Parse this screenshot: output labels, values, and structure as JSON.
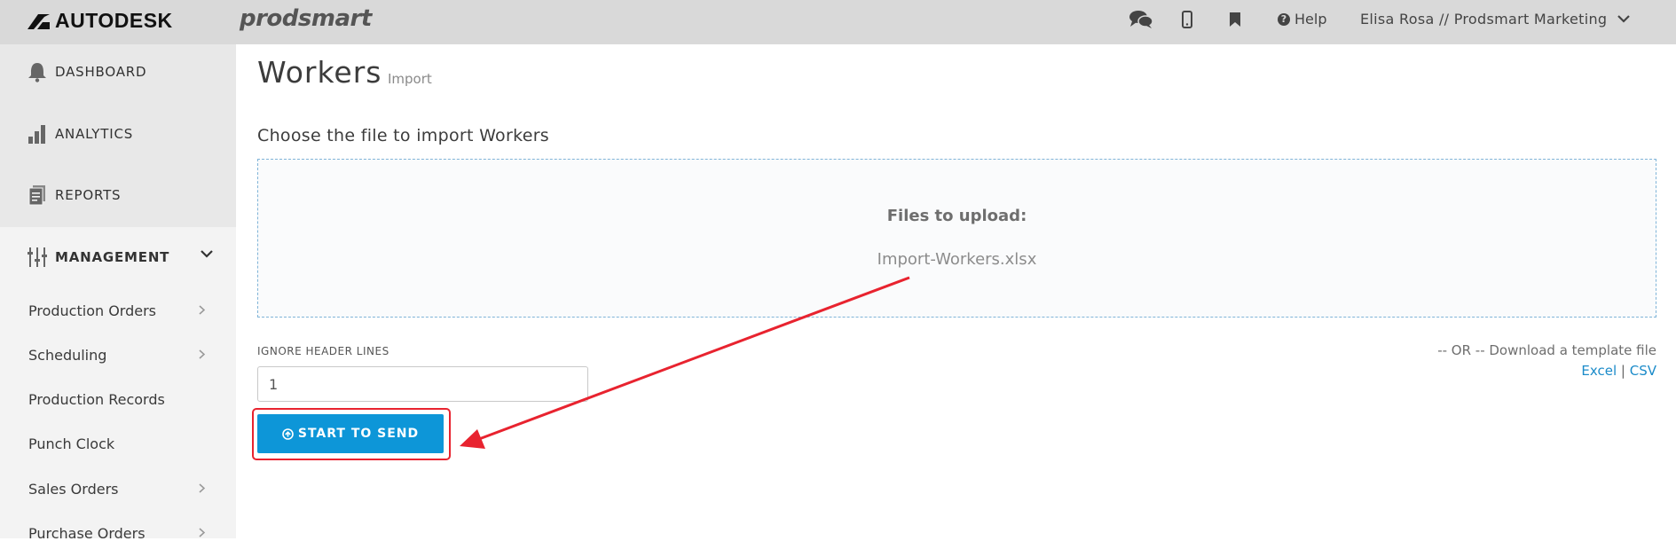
{
  "header": {
    "brand": "AUTODESK",
    "product": "prodsmart",
    "help_label": "Help",
    "user_label": "Elisa Rosa // Prodsmart Marketing"
  },
  "sidebar": {
    "main_items": [
      {
        "label": "DASHBOARD",
        "icon": "bell-icon"
      },
      {
        "label": "ANALYTICS",
        "icon": "bar-chart-icon"
      },
      {
        "label": "REPORTS",
        "icon": "report-icon"
      },
      {
        "label": "MANAGEMENT",
        "icon": "sliders-icon"
      }
    ],
    "sub_items": [
      {
        "label": "Production Orders",
        "has_chevron": true
      },
      {
        "label": "Scheduling",
        "has_chevron": true
      },
      {
        "label": "Production Records",
        "has_chevron": false
      },
      {
        "label": "Punch Clock",
        "has_chevron": false
      },
      {
        "label": "Sales Orders",
        "has_chevron": true
      },
      {
        "label": "Purchase Orders",
        "has_chevron": true
      }
    ]
  },
  "main": {
    "title": "Workers",
    "subtitle": "Import",
    "section_heading": "Choose the file to import Workers",
    "dropzone": {
      "title": "Files to upload:",
      "file_name": "Import-Workers.xlsx"
    },
    "ignore_header": {
      "label": "IGNORE HEADER LINES",
      "value": "1"
    },
    "download": {
      "text": "-- OR -- Download a template file",
      "excel_label": "Excel",
      "separator": "|",
      "csv_label": "CSV"
    },
    "start_button_label": "START TO SEND"
  },
  "colors": {
    "accent": "#0d96d8",
    "link": "#1b8bc9",
    "annotation": "#e8232f",
    "topbar": "#d9d9d9"
  }
}
